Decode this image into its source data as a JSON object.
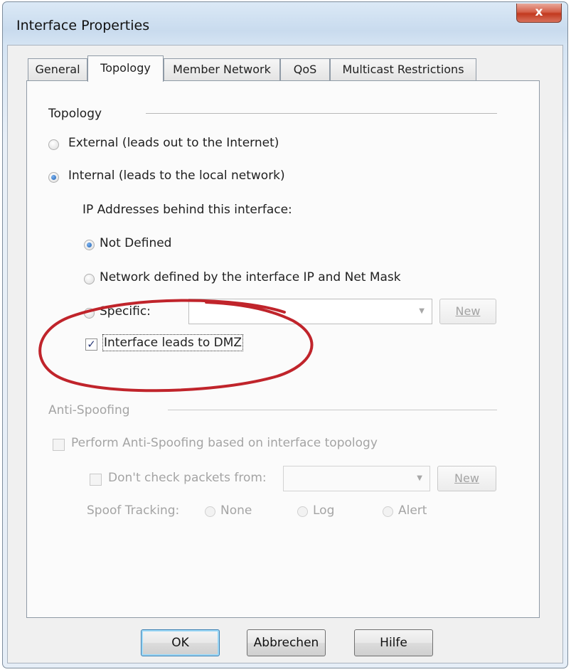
{
  "window": {
    "title": "Interface Properties",
    "close_label": "x"
  },
  "tabs": [
    "General",
    "Topology",
    "Member Network",
    "QoS",
    "Multicast Restrictions"
  ],
  "active_tab": "Topology",
  "topology": {
    "section_title": "Topology",
    "external_label": "External (leads out to the Internet)",
    "internal_label": "Internal (leads to the local network)",
    "ip_heading": "IP Addresses behind this interface:",
    "not_defined_label": "Not Defined",
    "network_defined_label": "Network defined by the interface IP and Net Mask",
    "specific_label": "Specific:",
    "specific_value": "",
    "new_label": "New",
    "dmz_label": "Interface leads to DMZ",
    "dmz_checked": true
  },
  "anti_spoofing": {
    "section_title": "Anti-Spoofing",
    "perform_label": "Perform Anti-Spoofing based on interface topology",
    "dont_check_label": "Don't check packets from:",
    "dont_check_value": "",
    "new_label": "New",
    "spoof_tracking_label": "Spoof Tracking:",
    "none_label": "None",
    "log_label": "Log",
    "alert_label": "Alert"
  },
  "buttons": {
    "ok": "OK",
    "cancel": "Abbrechen",
    "help": "Hilfe"
  },
  "colors": {
    "highlight_ellipse": "#c0242b",
    "selected_radio": "#1e5fb0"
  }
}
